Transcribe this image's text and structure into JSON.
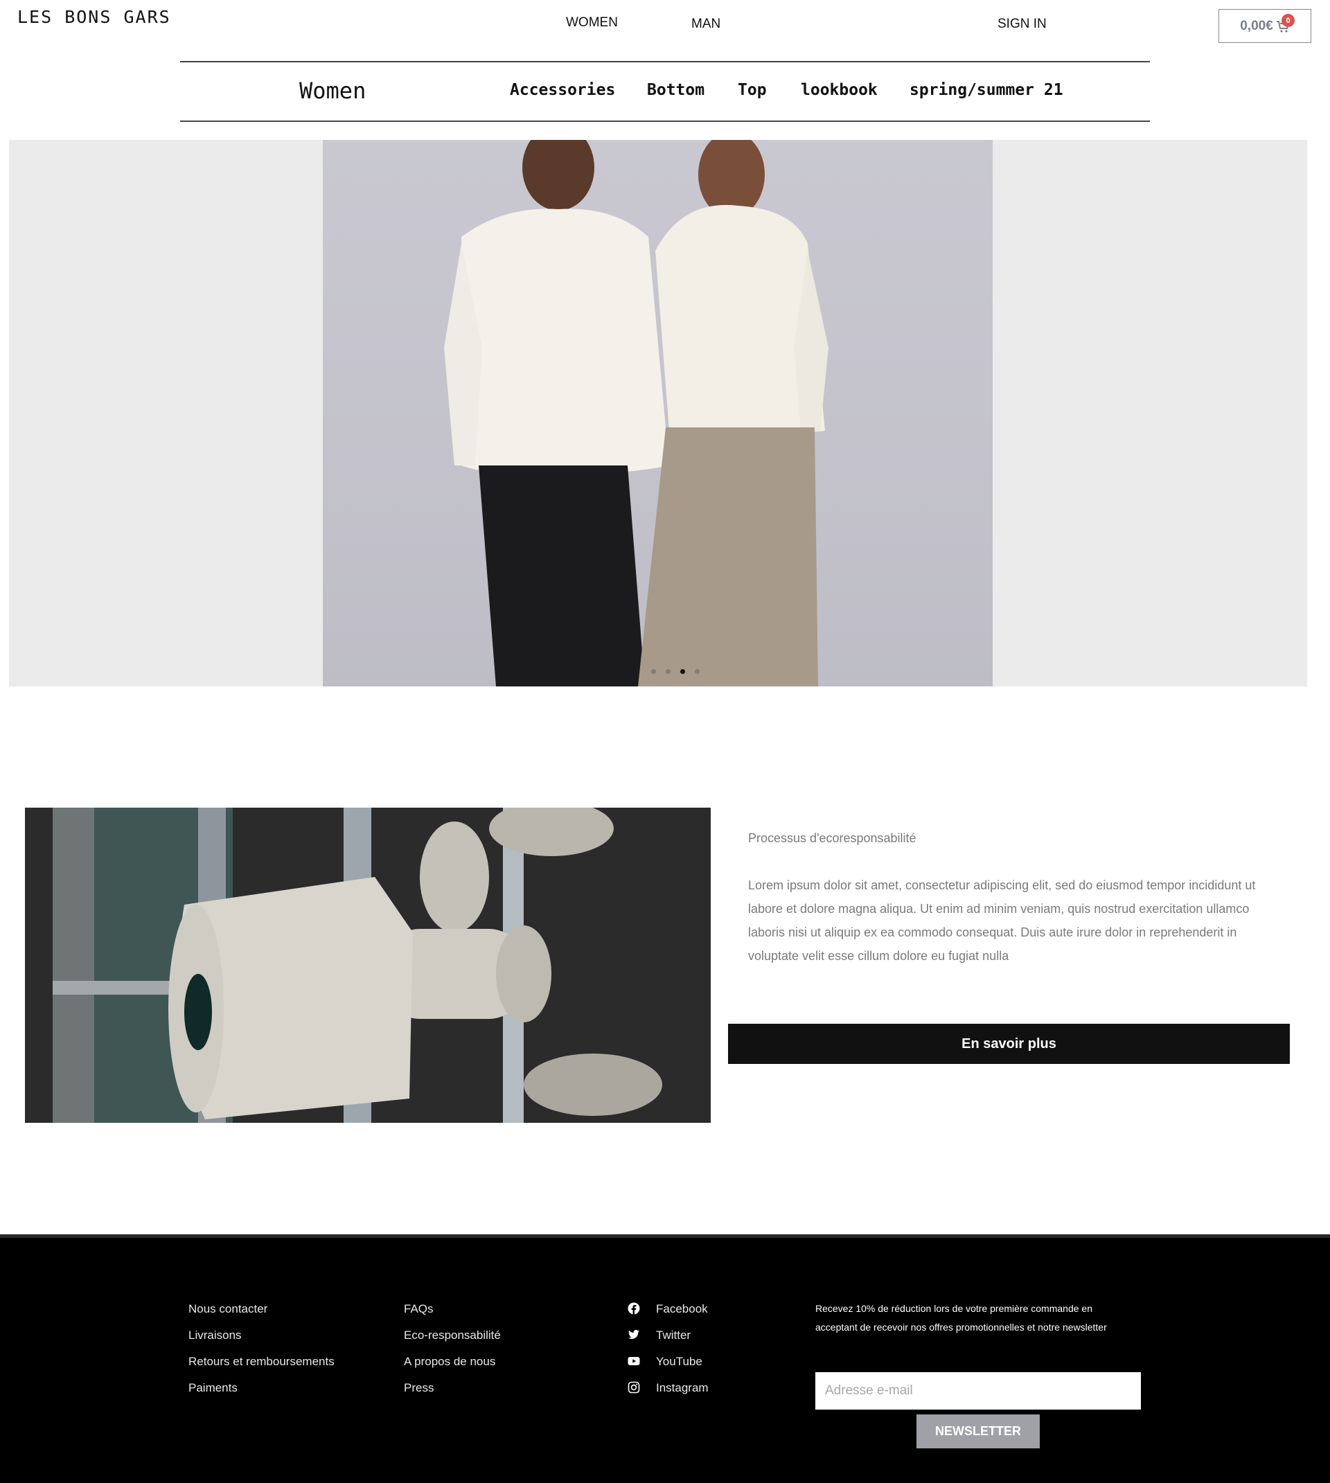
{
  "header": {
    "logo": "LES BONS GARS",
    "nav": [
      "WOMEN",
      "MAN"
    ],
    "sign_in": "SIGN IN",
    "cart_total": "0,00€",
    "cart_count": "0"
  },
  "category_nav": {
    "title": "Women",
    "items": [
      "Accessories",
      "Bottom",
      "Top",
      "lookbook",
      "spring/summer 21"
    ]
  },
  "hero": {
    "slide_count": 4,
    "active_slide": 3
  },
  "feature": {
    "subtitle": "Processus d'ecoresponsabilité",
    "body": "Lorem ipsum dolor sit amet, consectetur adipiscing elit, sed do eiusmod tempor incididunt ut labore et dolore magna aliqua. Ut enim ad minim veniam, quis nostrud exercitation ullamco laboris nisi ut aliquip ex ea commodo consequat. Duis aute irure dolor in reprehenderit in voluptate velit esse cillum dolore eu fugiat nulla",
    "button": "En savoir plus"
  },
  "footer": {
    "col1": [
      "Nous contacter",
      "Livraisons",
      "Retours et remboursements",
      "Paiments"
    ],
    "col2": [
      "FAQs",
      "Eco-responsabilité",
      "A propos de nous",
      "Press"
    ],
    "social": [
      {
        "label": "Facebook",
        "icon": "facebook-icon"
      },
      {
        "label": "Twitter",
        "icon": "twitter-icon"
      },
      {
        "label": "YouTube",
        "icon": "youtube-icon"
      },
      {
        "label": "Instagram",
        "icon": "instagram-icon"
      }
    ],
    "promo": "Recevez 10% de réduction lors de votre première commande en acceptant de recevoir nos offres promotionnelles et notre newsletter",
    "email_placeholder": "Adresse e-mail",
    "newsletter_button": "NEWSLETTER"
  },
  "colors": {
    "footer_bg": "#000000",
    "button_dark": "#111111",
    "badge": "#d9534f",
    "newsletter_button": "#a0a1a6",
    "hero_bg": "#ebebeb"
  }
}
